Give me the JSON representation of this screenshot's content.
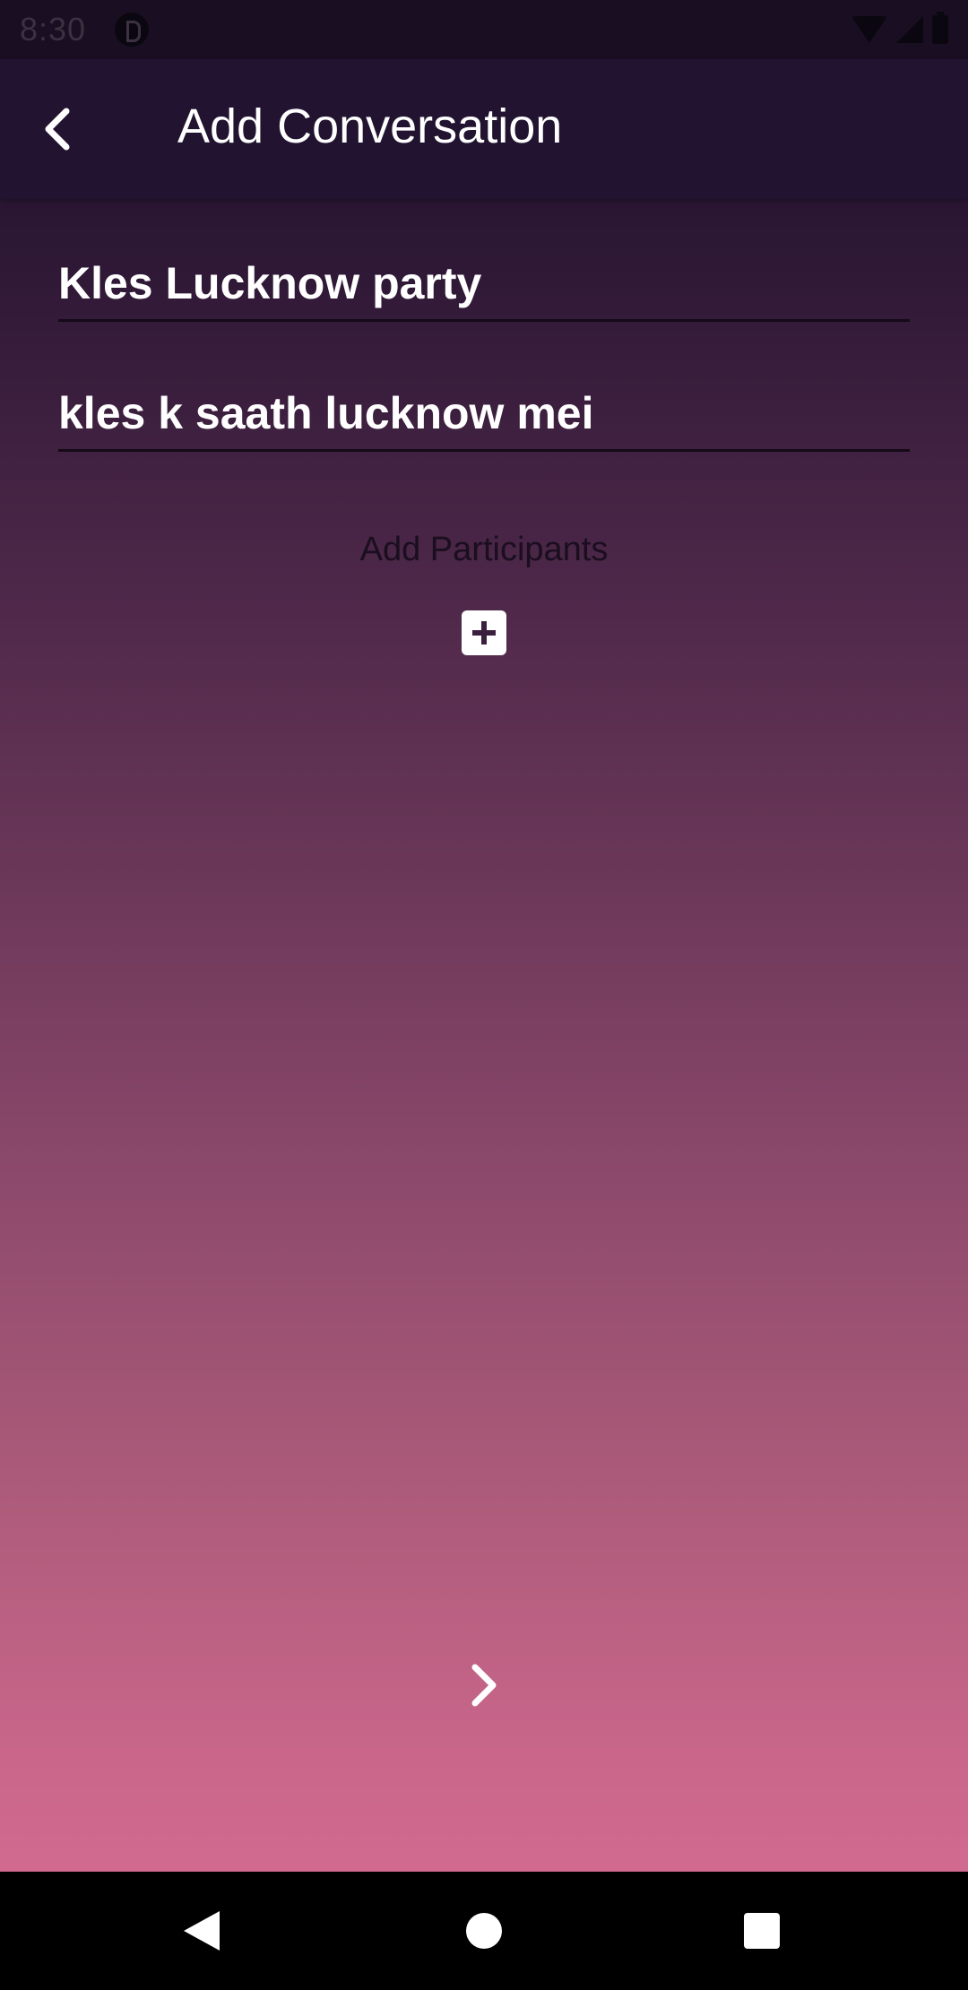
{
  "status_bar": {
    "time": "8:30",
    "icons": [
      "app-notification-icon",
      "wifi-icon",
      "signal-icon",
      "battery-icon"
    ]
  },
  "app_bar": {
    "title": "Add Conversation",
    "back_icon": "chevron-left-icon"
  },
  "form": {
    "title_field": {
      "value": "Kles Lucknow party"
    },
    "description_field": {
      "value": "kles k saath lucknow mei"
    },
    "participants_label": "Add Participants",
    "add_participant_icon": "plus-square-icon",
    "next_icon": "chevron-right-icon"
  },
  "nav_bar": {
    "buttons": [
      "back-triangle-icon",
      "home-circle-icon",
      "recents-square-icon"
    ]
  },
  "colors": {
    "gradient_top": "#1e1029",
    "gradient_bottom": "#d96f93",
    "app_bar": "#221431",
    "text": "#ffffff"
  }
}
